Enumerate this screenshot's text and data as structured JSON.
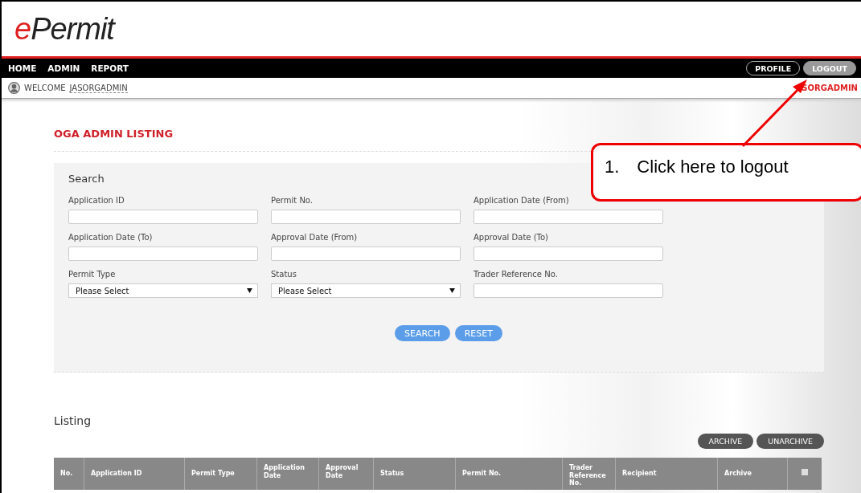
{
  "logo": {
    "accent": "e",
    "rest": "Permit"
  },
  "nav": {
    "items": [
      {
        "label": "HOME"
      },
      {
        "label": "ADMIN"
      },
      {
        "label": "REPORT"
      }
    ],
    "buttons": [
      {
        "label": "PROFILE",
        "selected": false
      },
      {
        "label": "LOGOUT",
        "selected": true
      }
    ]
  },
  "welcome": {
    "label": "WELCOME",
    "user": "JASORGADMIN",
    "right_user": "SORGADMIN"
  },
  "page_title": "OGA ADMIN LISTING",
  "search": {
    "title": "Search",
    "fields": [
      {
        "label": "Application ID",
        "kind": "text"
      },
      {
        "label": "Permit No.",
        "kind": "text"
      },
      {
        "label": "Application Date (From)",
        "kind": "text"
      },
      {
        "label": "Application Date (To)",
        "kind": "text"
      },
      {
        "label": "Approval Date (From)",
        "kind": "text"
      },
      {
        "label": "Approval Date (To)",
        "kind": "text"
      },
      {
        "label": "Permit Type",
        "kind": "select",
        "value": "Please Select"
      },
      {
        "label": "Status",
        "kind": "select",
        "value": "Please Select"
      },
      {
        "label": "Trader Reference No.",
        "kind": "text"
      }
    ],
    "buttons": [
      "SEARCH",
      "RESET"
    ]
  },
  "listing": {
    "title": "Listing",
    "buttons": [
      "ARCHIVE",
      "UNARCHIVE"
    ],
    "columns": [
      "No.",
      "Application ID",
      "Permit Type",
      "Application Date",
      "Approval Date",
      "Status",
      "Permit No.",
      "Trader Reference No.",
      "Recipient",
      "Archive"
    ],
    "select_all": {
      "checked": false
    }
  },
  "callout": {
    "number": "1.",
    "text": "Click here to logout"
  }
}
